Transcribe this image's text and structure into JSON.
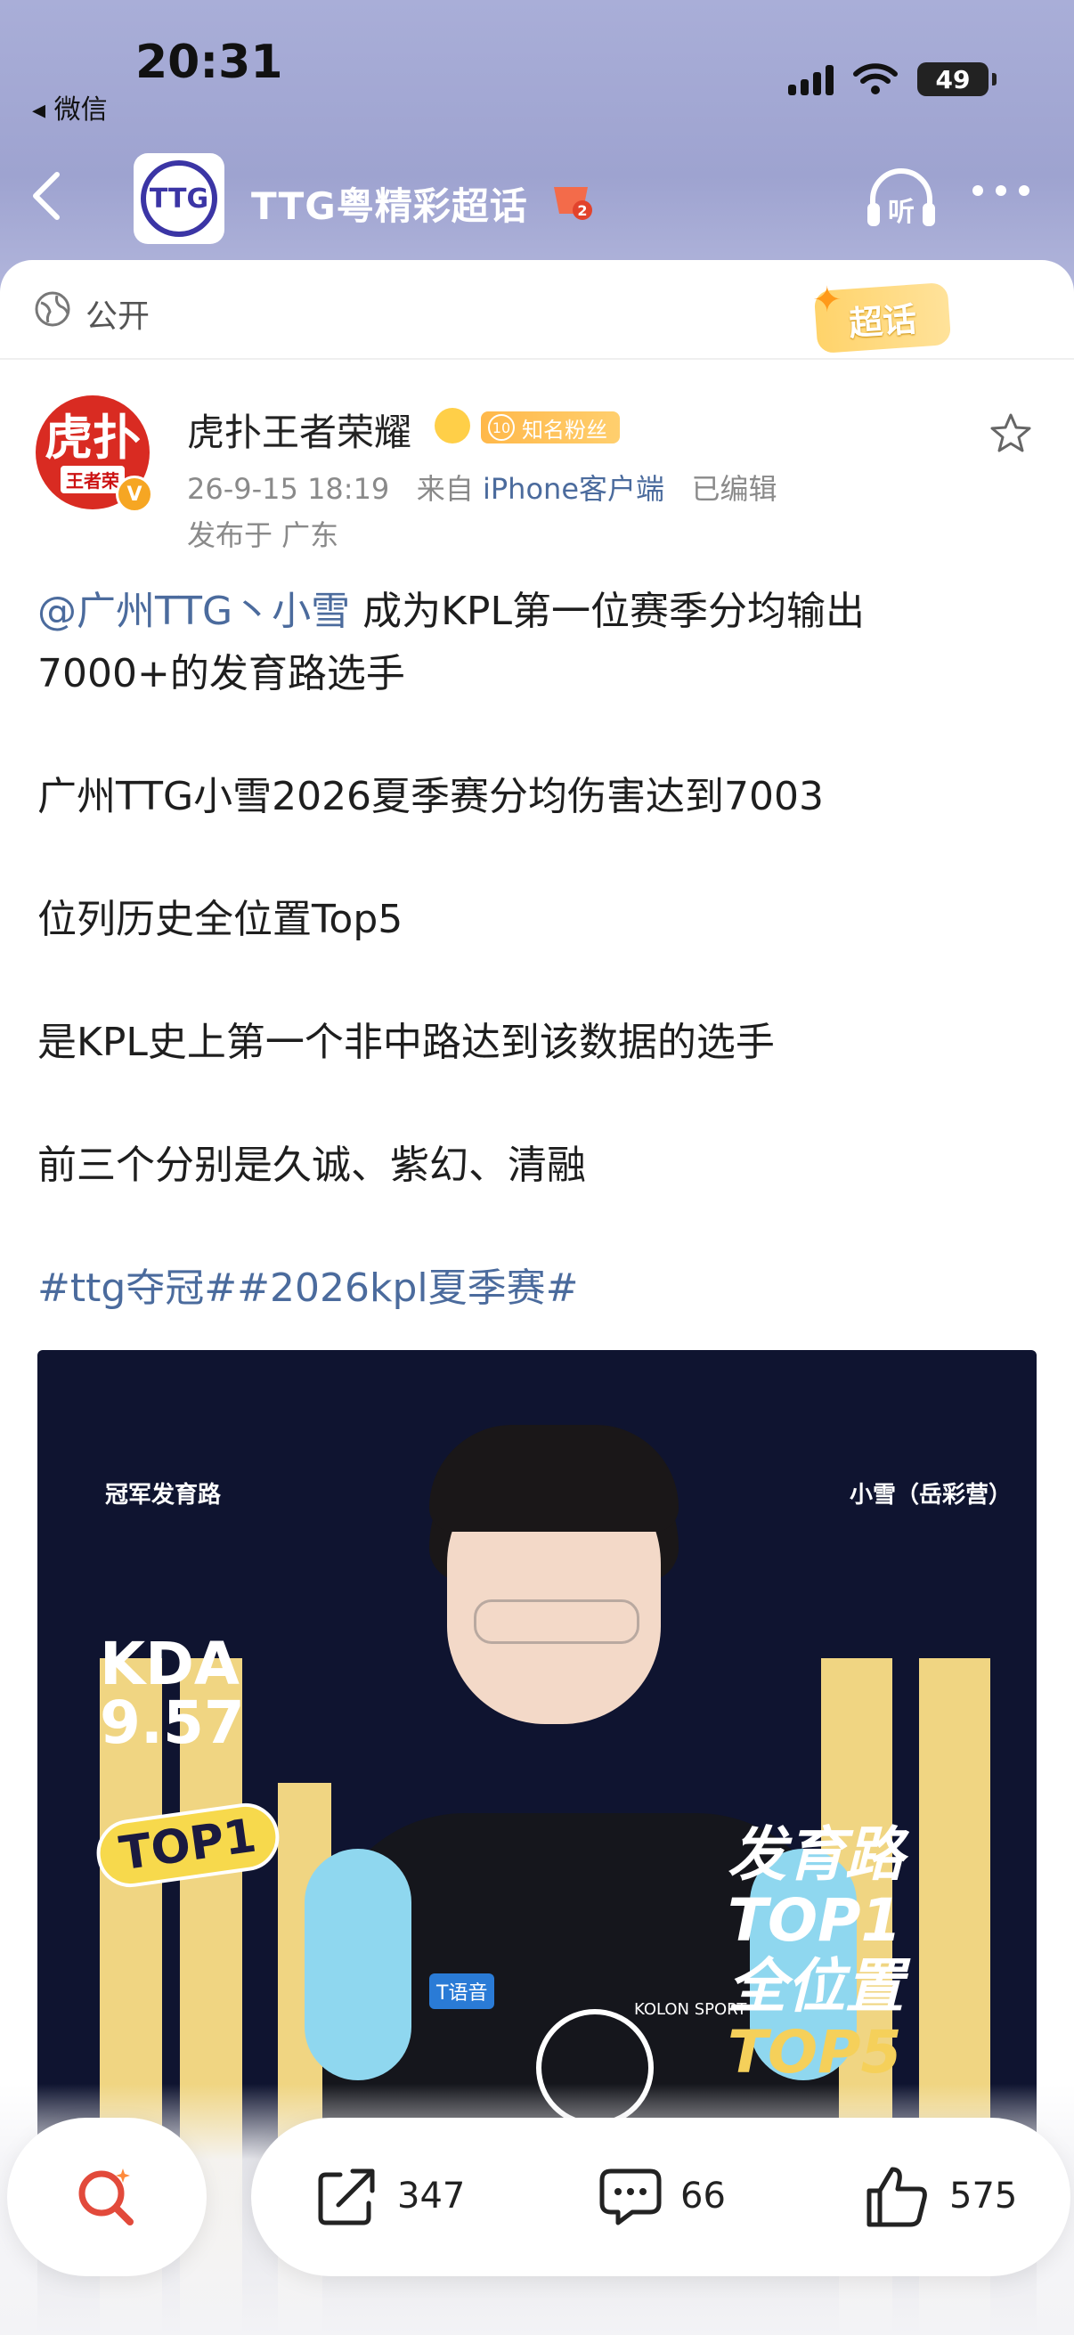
{
  "status_bar": {
    "time": "20:31",
    "back_app": "◂ 微信",
    "battery": "49"
  },
  "nav": {
    "title": "TTG粤精彩超话",
    "badge_level": "2",
    "logo_text": "TTG"
  },
  "post_header": {
    "visibility": "公开",
    "chaohua_tag": "超话",
    "author": "虎扑王者荣耀",
    "avatar_big": "虎扑",
    "avatar_small": "王者荣",
    "verify_mark": "V",
    "fan_level": "10",
    "fan_label": "知名粉丝",
    "time": "26-9-15 18:19",
    "from_prefix": "来自",
    "source": "iPhone客户端",
    "edited": "已编辑",
    "location": "发布于 广东"
  },
  "post_body": {
    "mention": "@广州TTG丶小雪",
    "line1_rest": " 成为KPL第一位赛季分均输出7000+的发育路选手",
    "para2": "广州TTG小雪2026夏季赛分均伤害达到7003",
    "para3": "位列历史全位置Top5",
    "para4": "是KPL史上第一个非中路达到该数据的选手",
    "para5": "前三个分别是久诚、紫幻、清融",
    "tags": "#ttg夺冠##2026kpl夏季赛#"
  },
  "post_image": {
    "tag_left": "冠军发育路",
    "tag_right": "小雪（岳彩营）",
    "kda_label": "KDA",
    "kda_value": "9.57",
    "top1": "TOP1",
    "rank_line1": "发育路TOP1",
    "rank_line2_a": "全位置",
    "rank_line2_b": "TOP5",
    "sponsor": "KOLON SPORT",
    "patch": "T语音"
  },
  "actions": {
    "share": "347",
    "comment": "66",
    "like": "575"
  },
  "colors": {
    "header": "#a9aed8",
    "link": "#4b6b9d",
    "avatar": "#d92b22",
    "image_bg": "#0f1430",
    "gold": "#f0d582"
  }
}
